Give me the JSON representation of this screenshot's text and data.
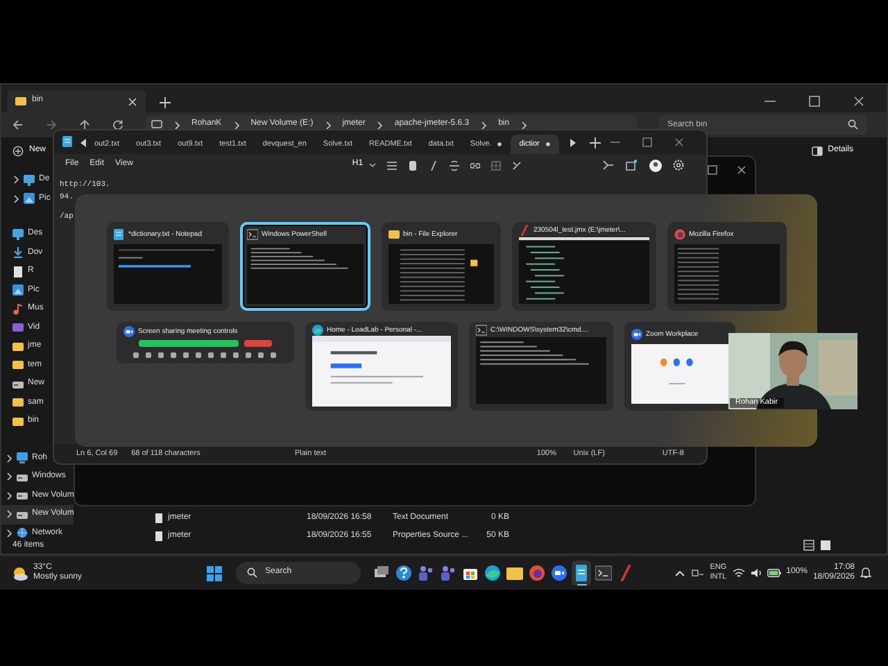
{
  "explorer": {
    "tabs": [
      {
        "label": "bin",
        "selected": true
      }
    ],
    "breadcrumbs": [
      "RohanK",
      "New Volume (E:)",
      "jmeter",
      "apache-jmeter-5.6.3",
      "bin"
    ],
    "search": {
      "placeholder": "Search bin"
    },
    "toolbar": {
      "new": "New",
      "details": "Details"
    },
    "sidebar_top": [
      {
        "label": "De",
        "kind": "monitor"
      },
      {
        "label": "Pic"
      }
    ],
    "sidebar_quick": [
      {
        "label": "Des",
        "kind": "monitor"
      },
      {
        "label": "Dov",
        "kind": "download"
      },
      {
        "label": "R",
        "kind": "doc"
      },
      {
        "label": "Pic"
      },
      {
        "label": "Mus",
        "kind": "music"
      },
      {
        "label": "Vid",
        "kind": "video"
      },
      {
        "label": "jme",
        "kind": "folder"
      },
      {
        "label": "tem",
        "kind": "folder"
      },
      {
        "label": "New",
        "kind": "drive"
      },
      {
        "label": "sam",
        "kind": "folder"
      },
      {
        "label": "bin",
        "kind": "folder"
      }
    ],
    "sidebar_tree": [
      {
        "label": "Roh",
        "kind": "pc",
        "selected": false
      },
      {
        "label": "Windows",
        "kind": "drive",
        "selected": false
      },
      {
        "label": "New Volum",
        "kind": "drive",
        "selected": false
      },
      {
        "label": "New Volum",
        "kind": "drive",
        "selected": true
      },
      {
        "label": "Network",
        "kind": "network",
        "selected": false
      }
    ],
    "files": [
      {
        "name": "jmeter",
        "modified": "18/09/2026 16:58",
        "type": "Text Document",
        "size": "0 KB"
      },
      {
        "name": "jmeter",
        "modified": "18/09/2026 16:55",
        "type": "Properties Source ...",
        "size": "50 KB"
      }
    ],
    "status": "46 items"
  },
  "notepad": {
    "tabs": [
      {
        "label": "out2.txt",
        "selected": false
      },
      {
        "label": "out3.txt",
        "selected": false
      },
      {
        "label": "out9.txt",
        "selected": false
      },
      {
        "label": "test1.txt",
        "selected": false
      },
      {
        "label": "devquest_en",
        "selected": false
      },
      {
        "label": "Solve.txt",
        "selected": false
      },
      {
        "label": "README.txt",
        "selected": false
      },
      {
        "label": "data.txt",
        "selected": false
      },
      {
        "label": "Solve.",
        "selected": false
      },
      {
        "label": "dictior",
        "selected": true
      }
    ],
    "menu": [
      "File",
      "Edit",
      "View"
    ],
    "heading": "H1",
    "lines": [
      "http://103.",
      "94.",
      "/ap"
    ],
    "status": [
      "Ln 6, Col 69",
      "68 of 118 characters",
      "Plain text",
      "100%",
      "Unix (LF)",
      "UTF-8"
    ]
  },
  "task_switcher": {
    "row_1": [
      {
        "title": "*dictionary.txt - Notepad",
        "kind": "notepad",
        "selected": false
      },
      {
        "title": "Windows PowerShell",
        "kind": "powershell",
        "selected": true
      },
      {
        "title": "bin - File Explorer",
        "kind": "explorer",
        "selected": false
      },
      {
        "title": "230504l_test.jmx (E:\\jmeter\\...",
        "kind": "jmeter",
        "selected": false
      },
      {
        "title": "Mozilla Firefox",
        "kind": "firefox",
        "selected": false
      }
    ],
    "row_2": [
      {
        "title": "Screen sharing meeting controls",
        "kind": "zoombar",
        "selected": false
      },
      {
        "title": "Home - LoadLab - Personal -...",
        "kind": "edge",
        "selected": false
      },
      {
        "title": "C:\\WINDOWS\\system32\\cmd....",
        "kind": "cmd",
        "selected": false
      },
      {
        "title": "Zoom Workplace",
        "kind": "zoom",
        "selected": false
      }
    ]
  },
  "webcam": {
    "name": "Rohan Kabir"
  },
  "taskbar": {
    "temperature": "33°C",
    "weather": "Mostly sunny",
    "search": "Search",
    "apps": [
      {
        "kind": "taskview",
        "active": false
      },
      {
        "kind": "help",
        "active": false
      },
      {
        "kind": "teams",
        "active": false
      },
      {
        "kind": "teams",
        "active": false
      },
      {
        "kind": "store",
        "active": false
      },
      {
        "kind": "edge",
        "active": false
      },
      {
        "kind": "explorer",
        "active": false
      },
      {
        "kind": "firefox",
        "active": false
      },
      {
        "kind": "zoom",
        "active": false
      },
      {
        "kind": "notepad",
        "active": true
      },
      {
        "kind": "terminal",
        "active": false
      },
      {
        "kind": "jmeter",
        "active": false
      }
    ],
    "language": [
      "ENG",
      "INTL"
    ],
    "battery": "100%",
    "time": "17:08",
    "date": "18/09/2026"
  }
}
